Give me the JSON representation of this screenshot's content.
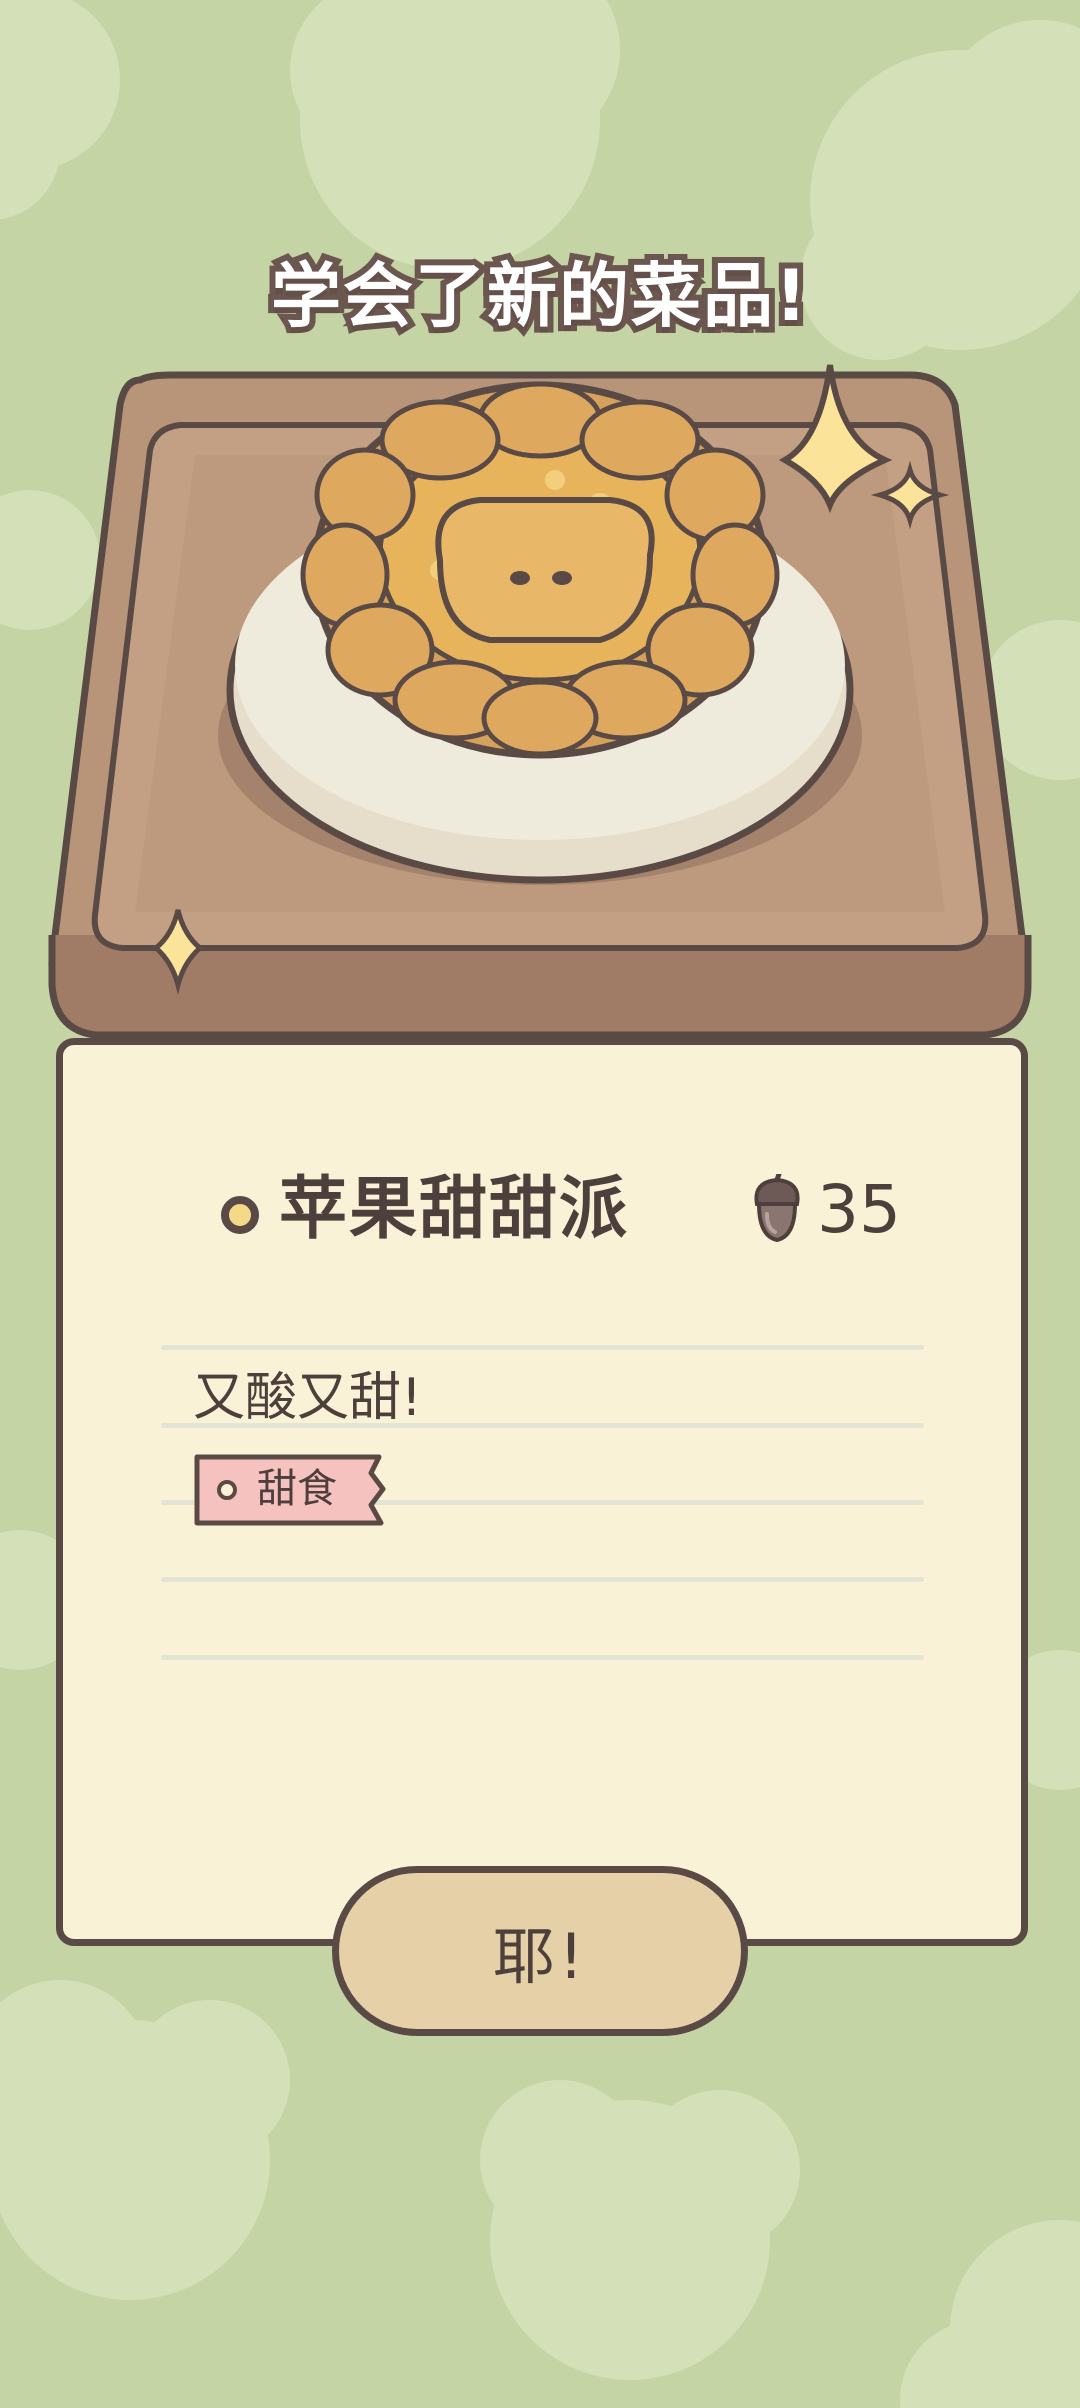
{
  "headline": "学会了新的菜品!",
  "recipe": {
    "name": "苹果甜甜派",
    "price": "35",
    "price_icon": "acorn-icon",
    "description": "又酸又甜!",
    "tag": "甜食",
    "image": "apple-pie"
  },
  "confirm_button": "耶!",
  "colors": {
    "background": "#c5d4a4",
    "card": "#faf2d6",
    "outline": "#5a4a46",
    "tray": "#b89479",
    "button": "#e5d0a8",
    "tag": "#f6c2c0",
    "sparkle": "#fbe39a"
  }
}
